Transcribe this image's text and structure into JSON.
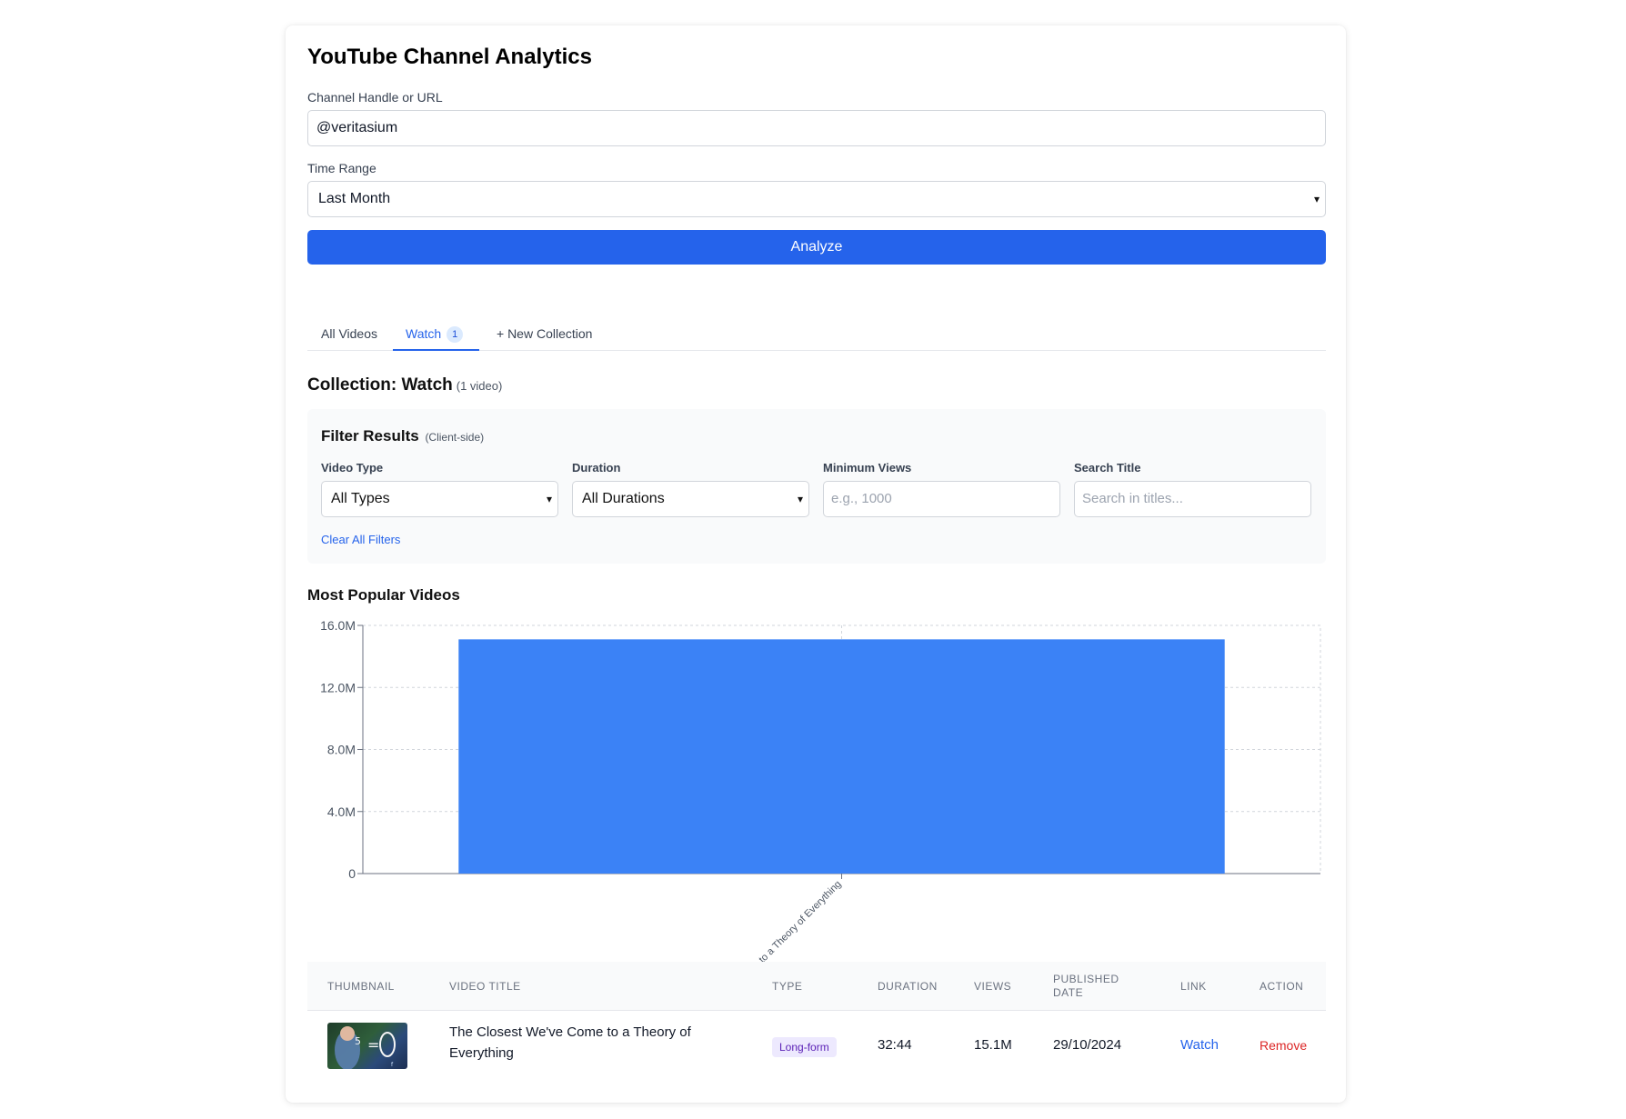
{
  "app": {
    "title": "YouTube Channel Analytics"
  },
  "form": {
    "channel_label": "Channel Handle or URL",
    "channel_value": "@veritasium",
    "range_label": "Time Range",
    "range_value": "Last Month",
    "analyze_label": "Analyze"
  },
  "tabs": {
    "all_videos": "All Videos",
    "watch": "Watch",
    "watch_count": "1",
    "new_collection": "+ New Collection"
  },
  "collection": {
    "title": "Collection: Watch",
    "count": "(1 video)"
  },
  "filters": {
    "title": "Filter Results",
    "subtitle": "(Client-side)",
    "video_type_label": "Video Type",
    "video_type_value": "All Types",
    "duration_label": "Duration",
    "duration_value": "All Durations",
    "min_views_label": "Minimum Views",
    "min_views_placeholder": "e.g., 1000",
    "search_label": "Search Title",
    "search_placeholder": "Search in titles...",
    "clear_label": "Clear All Filters"
  },
  "chart_data": {
    "type": "bar",
    "title": "Most Popular Videos",
    "categories": [
      "to a Theory of Everything"
    ],
    "values": [
      15100000
    ],
    "ylim": [
      0,
      16000000
    ],
    "yticks": [
      0,
      4000000,
      8000000,
      12000000,
      16000000
    ],
    "ytick_labels": [
      "0",
      "4.0M",
      "8.0M",
      "12.0M",
      "16.0M"
    ],
    "grid": true,
    "bar_color": "#3b82f6"
  },
  "table": {
    "headers": {
      "thumbnail": "Thumbnail",
      "title": "Video Title",
      "type": "Type",
      "duration": "Duration",
      "views": "Views",
      "published": "Published Date",
      "link": "Link",
      "action": "Action"
    },
    "rows": [
      {
        "title": "The Closest We've Come to a Theory of Everything",
        "type": "Long-form",
        "duration": "32:44",
        "views": "15.1M",
        "published": "29/10/2024",
        "link": "Watch",
        "action": "Remove"
      }
    ]
  },
  "colors": {
    "accent": "#2563eb",
    "bar": "#3b82f6",
    "danger": "#dc2626",
    "badge_bg": "#ede9fe"
  }
}
